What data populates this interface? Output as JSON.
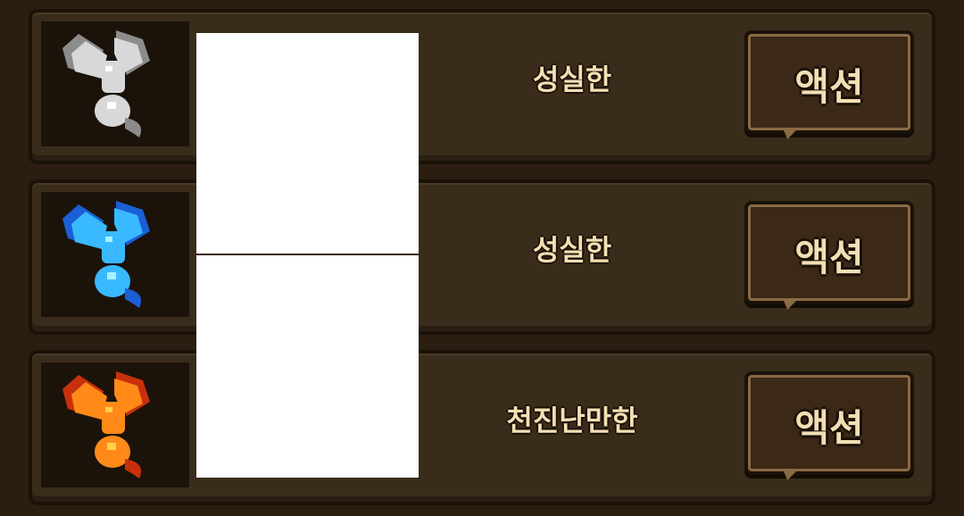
{
  "rows": [
    {
      "trait": "성실한",
      "action_label": "액션",
      "creature_icon": "gray-dragon-icon",
      "colors": {
        "body": "#d8d8d8",
        "shade": "#8c8c8c",
        "accent": "#ffffff"
      }
    },
    {
      "trait": "성실한",
      "action_label": "액션",
      "creature_icon": "blue-dragon-icon",
      "colors": {
        "body": "#39b9ff",
        "shade": "#1b5fd6",
        "accent": "#a8f2ff"
      }
    },
    {
      "trait": "천진난만한",
      "action_label": "액션",
      "creature_icon": "fire-dragon-icon",
      "colors": {
        "body": "#ff8a1a",
        "shade": "#c8300c",
        "accent": "#ffd24a"
      }
    }
  ]
}
